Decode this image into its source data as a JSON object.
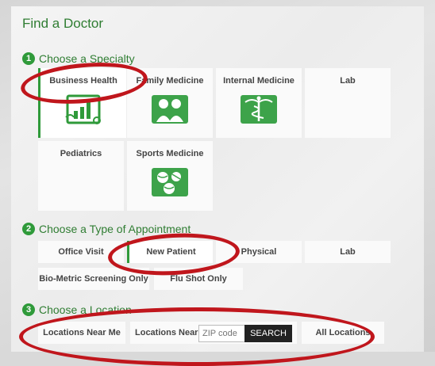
{
  "page_title": "Find a Doctor",
  "steps": {
    "specialty": {
      "num": "1",
      "label": "Choose a Specialty"
    },
    "appointment": {
      "num": "2",
      "label": "Choose a Type of Appointment"
    },
    "location": {
      "num": "3",
      "label": "Choose a Location"
    }
  },
  "specialties": [
    {
      "label": "Business Health",
      "icon": "business-health-chart-icon",
      "selected": true
    },
    {
      "label": "Family Medicine",
      "icon": "family-icon",
      "selected": false
    },
    {
      "label": "Internal Medicine",
      "icon": "caduceus-icon",
      "selected": false
    },
    {
      "label": "Lab",
      "icon": "",
      "selected": false
    },
    {
      "label": "Pediatrics",
      "icon": "",
      "selected": false
    },
    {
      "label": "Sports Medicine",
      "icon": "sports-balls-icon",
      "selected": false
    }
  ],
  "appointments": [
    {
      "label": "Office Visit",
      "selected": false
    },
    {
      "label": "New Patient",
      "selected": true
    },
    {
      "label": "Physical",
      "selected": false
    },
    {
      "label": "Lab",
      "selected": false
    },
    {
      "label": "Bio-Metric Screening Only",
      "selected": false
    },
    {
      "label": "Flu Shot Only",
      "selected": false
    }
  ],
  "location": {
    "near_me": "Locations Near Me",
    "near_label": "Locations Near",
    "zip_placeholder": "ZIP code",
    "search": "SEARCH",
    "all": "All Locations"
  },
  "colors": {
    "accent": "#2f9a3a",
    "title": "#2f7d32",
    "highlight_ring": "#c0161c"
  }
}
